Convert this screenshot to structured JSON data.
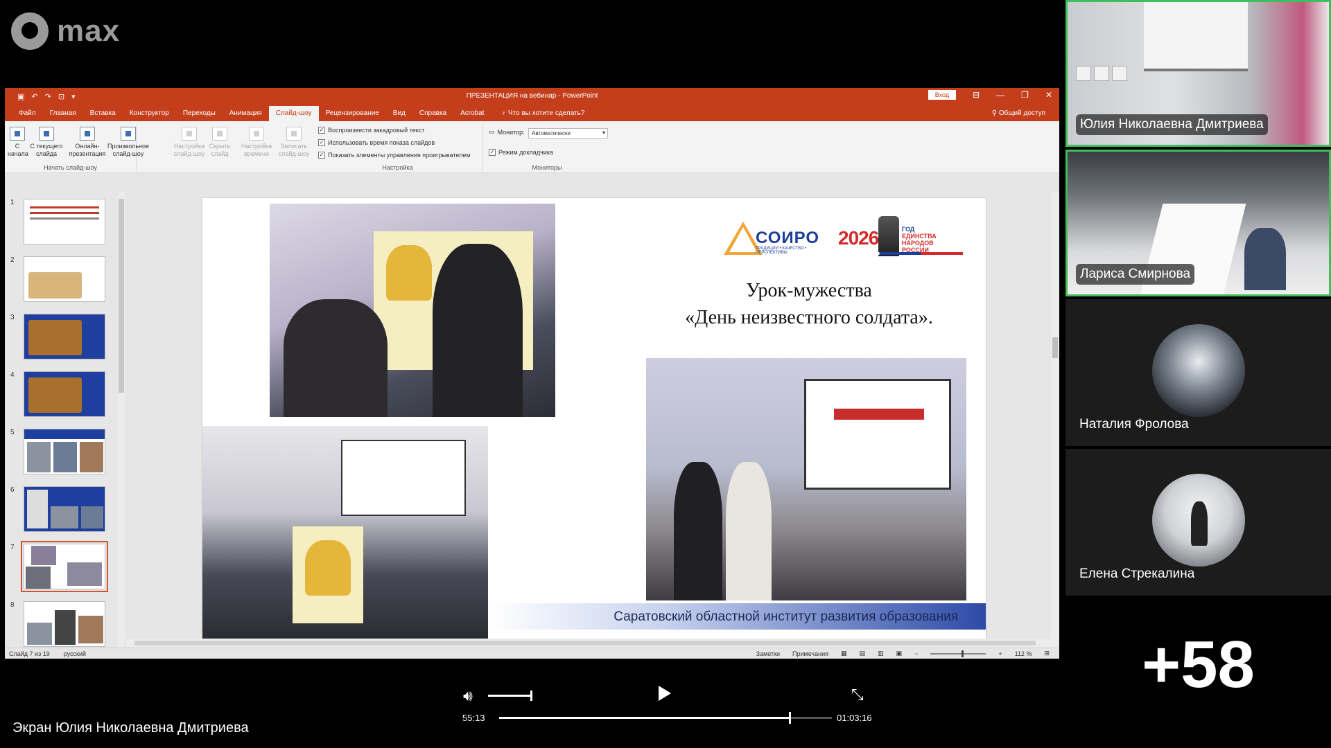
{
  "app": {
    "brand": "max"
  },
  "ppt": {
    "window_title": "ПРЕЗЕНТАЦИЯ на вебинар  -  PowerPoint",
    "signin": "Вход",
    "tabs": [
      "Файл",
      "Главная",
      "Вставка",
      "Конструктор",
      "Переходы",
      "Анимация",
      "Слайд-шоу",
      "Рецензирование",
      "Вид",
      "Справка",
      "Acrobat"
    ],
    "active_tab": "Слайд-шоу",
    "tell_me": "Что вы хотите сделать?",
    "share": "Общий доступ",
    "ribbon": {
      "start_group": "Начать слайд-шоу",
      "setup_group": "Настройка",
      "monitors_group": "Мониторы",
      "btn_from_start": "С начала",
      "btn_from_current": "С текущего слайда",
      "btn_online": "Онлайн-презентация",
      "btn_custom": "Произвольное слайд-шоу",
      "btn_setup": "Настройка слайд-шоу",
      "btn_hide": "Скрыть слайд",
      "btn_rehearse": "Настройка времени",
      "btn_record": "Записать слайд-шоу",
      "chk_narration": "Воспроизвести закадровый текст",
      "chk_timings": "Использовать время показа слайдов",
      "chk_media": "Показать элементы управления проигрывателем",
      "monitor_label": "Монитор:",
      "monitor_value": "Автоматически",
      "chk_presenter": "Режим докладчика"
    },
    "slide": {
      "title_line1": "Урок-мужества",
      "title_line2": "«День неизвестного солдата».",
      "footer": "Саратовский областной институт развития образования",
      "soiro": "СОИРО",
      "soiro_sub": "ТРАДИЦИИ • КАЧЕСТВО • ПЕРСПЕКТИВЫ",
      "year": "2026",
      "year_text_1": "ГОД",
      "year_text_2": "ЕДИНСТВА",
      "year_text_3": "НАРОДОВ",
      "year_text_4": "РОССИИ"
    },
    "thumbnails": [
      "1",
      "2",
      "3",
      "4",
      "5",
      "6",
      "7",
      "8"
    ],
    "selected_slide": "7",
    "status": {
      "slide_info": "Слайд 7 из 19",
      "language": "русский",
      "notes": "Заметки",
      "comments": "Примечания",
      "zoom": "112 %"
    }
  },
  "participants": [
    {
      "name": "Юлия Николаевна Дмитриева"
    },
    {
      "name": "Лариса Смирнова"
    },
    {
      "name": "Наталия Фролова"
    },
    {
      "name": "Елена Стрекалина"
    }
  ],
  "more_count": "+58",
  "player": {
    "screen_label": "Экран Юлия Николаевна Дмитриева",
    "current_time": "55:13",
    "total_time": "01:03:16",
    "progress": 0.873,
    "volume": 1.0
  },
  "colors": {
    "ppt_accent": "#c43e1c",
    "active_speaker": "#3fbf5a"
  },
  "icons": [
    "volume-icon",
    "play-icon",
    "collapse-icon",
    "user-icon",
    "search-icon"
  ]
}
